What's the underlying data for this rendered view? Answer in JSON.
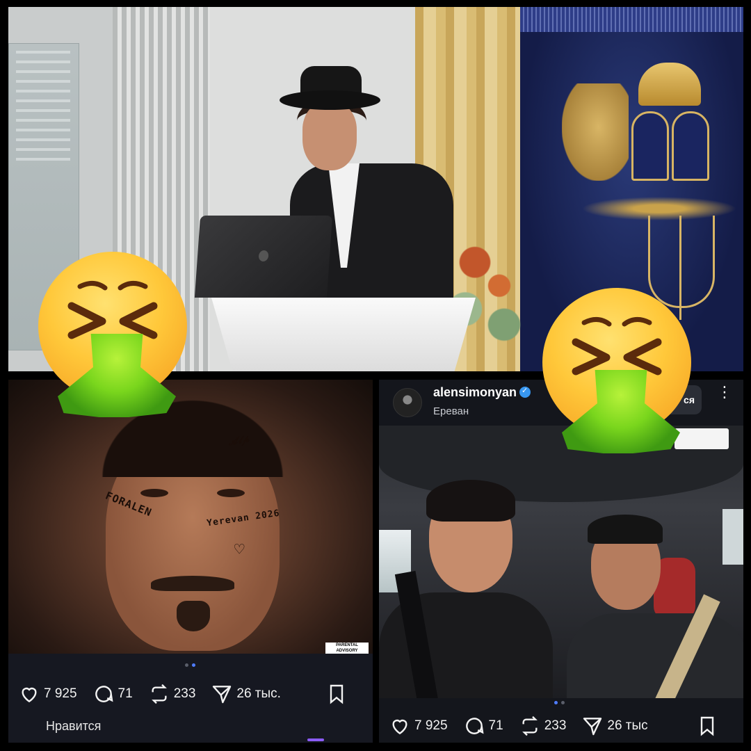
{
  "top_photo": {},
  "album_post": {
    "album_cover": {
      "tattoo_foralen": "FORALEN",
      "tattoo_yerevan": "Yerevan 2026",
      "tattoo_heart": "♡",
      "advisory_text": "PARENTAL ADVISORY"
    },
    "actions": {
      "likes": "7 925",
      "comments": "71",
      "reposts": "233",
      "shares": "26 тыс."
    },
    "likes_label": "Нравится",
    "carousel": {
      "count": 2,
      "active": 1
    }
  },
  "instagram_post": {
    "username": "alensimonyan",
    "verified": true,
    "location": "Ереван",
    "follow_label": "ся",
    "more_label": "⋮",
    "actions": {
      "likes": "7 925",
      "comments": "71",
      "reposts": "233",
      "shares": "26 тыс"
    },
    "carousel": {
      "count": 2,
      "active": 0
    }
  },
  "overlays": {
    "emoji": "nauseated-vomiting-face",
    "count": 2
  },
  "colors": {
    "accent_blue": "#4f7cff",
    "verified_blue": "#3897f0",
    "card_bg": "#161821",
    "purple": "#8b5cf6"
  }
}
